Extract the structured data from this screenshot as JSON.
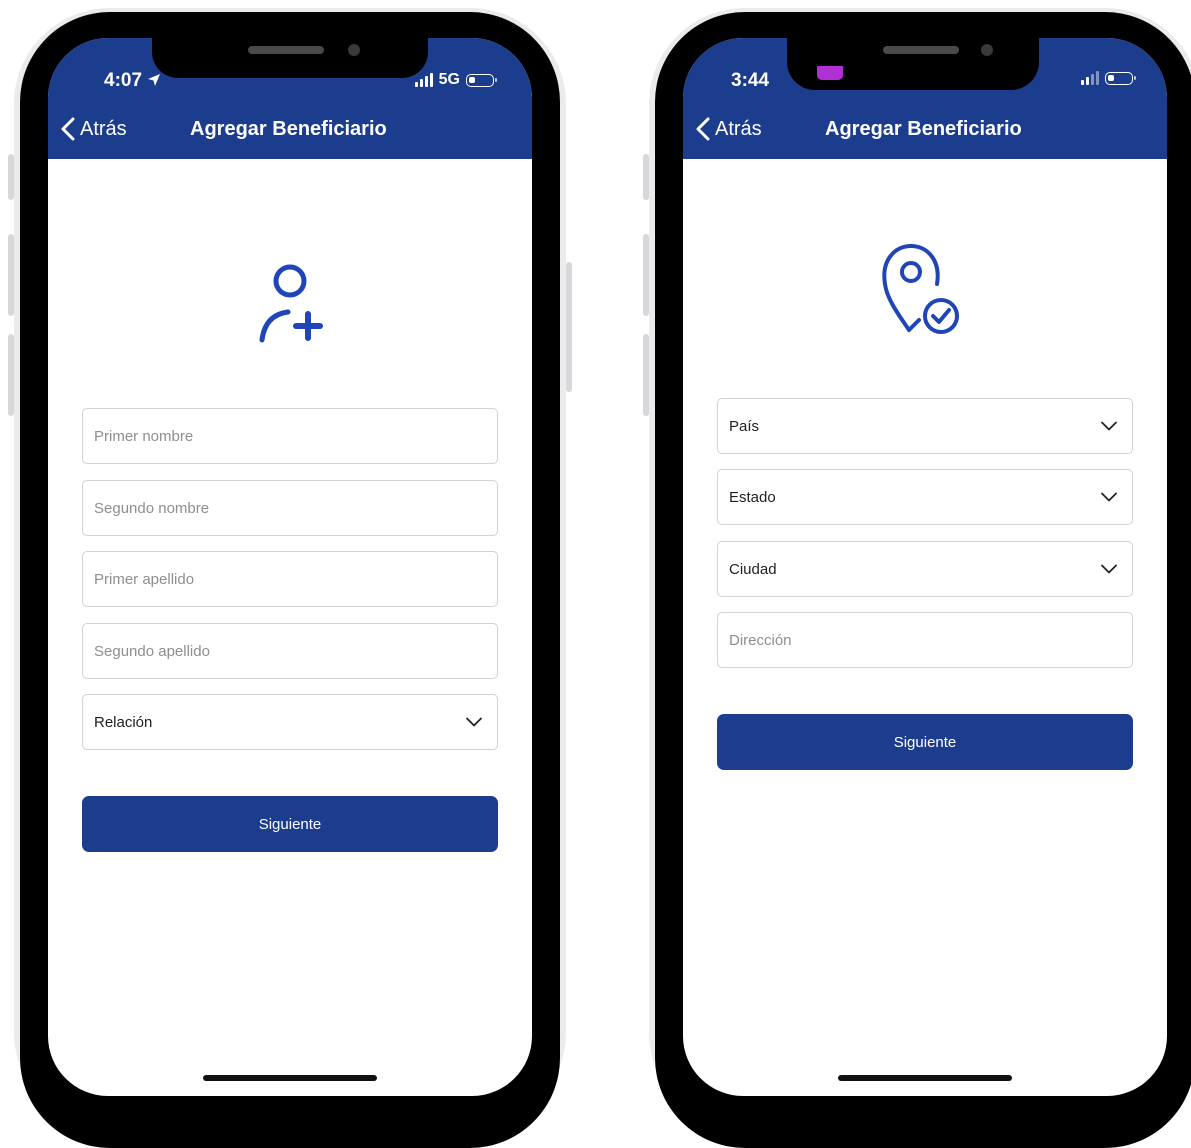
{
  "screens": [
    {
      "status_time": "4:07",
      "status_network": "5G",
      "back_label": "Atrás",
      "title": "Agregar Beneficiario",
      "hero_icon": "user-add-icon",
      "fields": [
        {
          "placeholder": "Primer nombre"
        },
        {
          "placeholder": "Segundo nombre"
        },
        {
          "placeholder": "Primer apellido"
        },
        {
          "placeholder": "Segundo apellido"
        }
      ],
      "selects": [
        {
          "value": "Relación"
        }
      ],
      "button_label": "Siguiente"
    },
    {
      "status_time": "3:44",
      "back_label": "Atrás",
      "title": "Agregar Beneficiario",
      "hero_icon": "location-check-icon",
      "selects": [
        {
          "value": "País"
        },
        {
          "value": "Estado"
        },
        {
          "value": "Ciudad"
        }
      ],
      "fields": [
        {
          "placeholder": "Dirección"
        }
      ],
      "button_label": "Siguiente"
    }
  ],
  "colors": {
    "primary": "#1c3d8e",
    "icon_blue": "#1f45b8",
    "border": "#d2d2d4",
    "placeholder": "#8e8e93"
  }
}
